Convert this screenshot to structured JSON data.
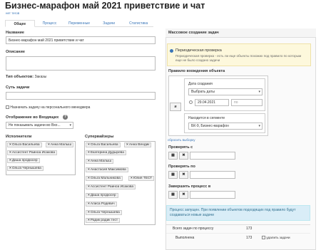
{
  "header": {
    "title": "Бизнес-марафон май 2021 приветствие и чат",
    "subtitle": "нет тегов"
  },
  "tabs": [
    {
      "label": "Общее",
      "active": true
    },
    {
      "label": "Процесс",
      "active": false
    },
    {
      "label": "Переменные",
      "active": false
    },
    {
      "label": "Задачи",
      "active": false
    },
    {
      "label": "Статистика",
      "active": false
    }
  ],
  "form": {
    "name_label": "Название",
    "name_value": "Бизнес-марафон май 2021 приветствие и чат",
    "description_label": "Описание",
    "description_value": "",
    "object_type_label": "Тип объектов:",
    "object_type_value": "Заказы",
    "task_essence_label": "Суть задачи",
    "task_essence_value": "",
    "assign_manager_label": "Назначать задачу на персонального менеджера",
    "inbox_display_label": "Отображение во Входящих",
    "inbox_display_value": "Не показывать задачи во Вхо...",
    "executors_label": "Исполнители",
    "executors": [
      "Ольга Васильева",
      "Анна Малыш",
      "Ассистент Раиноа Исакова",
      "Даша продюсер",
      "Ольга Чернышева"
    ],
    "supervisors_label": "Супервайзеры",
    "supervisors": [
      "Ольга Васильева",
      "Анна Вендик",
      "Екатерина Дудырева",
      "Анна Малыш",
      "Анастасия Максимова",
      "Ольга Мальникова",
      "Юлия ТЕСТ",
      "Ассистент Раиноа Исакова",
      "Даша продюсер",
      "Алиса Родевич",
      "Ольга Чернышева",
      "Радик радик тест"
    ]
  },
  "right": {
    "panel_title": "Массовое создание задач",
    "periodic_label": "Периодическая проверка",
    "periodic_desc": "Периодическая проверка - есть ли еще объекты похожих под правило по которым еще не было создано задачи",
    "rule_label": "Правило вхождения объекта",
    "and_label": "и",
    "date_created_label": "Дата создания",
    "date_select_value": "Выбрать даты",
    "date_from": "29.04.2021",
    "date_to_placeholder": "по",
    "segment_label": "Находится в сегменте",
    "segment_value": "БК-9, Бизнес-марафон",
    "reset_link": "сбросить выборку",
    "check_with_label": "Проверять с",
    "check_until_label": "Проверять по",
    "finish_label": "Завершить процесс в",
    "info_text": "Процесс запущен. При появлении объектов подходящих под правило будут создаваться новые задачи",
    "stats_total_label": "Всего задач по процессу",
    "stats_total_value": "173",
    "stats_done_label": "Выполнена",
    "stats_done_value": "173",
    "delete_tasks_label": "удалить задачи"
  }
}
